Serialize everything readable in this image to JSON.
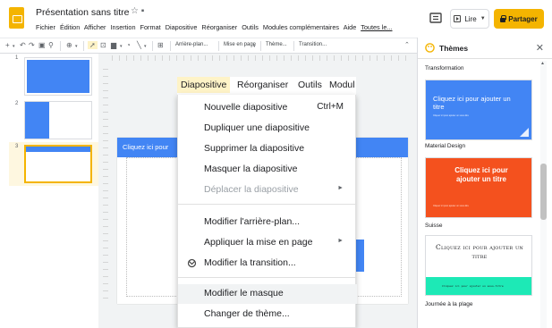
{
  "header": {
    "title": "Présentation sans titre",
    "menu": [
      "Fichier",
      "Édition",
      "Afficher",
      "Insertion",
      "Format",
      "Diapositive",
      "Réorganiser",
      "Outils",
      "Modules complémentaires",
      "Aide"
    ],
    "last_edit": "Toutes le...",
    "read_label": "Lire",
    "share_label": "Partager",
    "accent": "#f4b400"
  },
  "toolbar": {
    "background": "Arrière-plan...",
    "layout": "Mise en page",
    "theme": "Thème...",
    "transition": "Transition..."
  },
  "filmstrip": {
    "slides": [
      "1",
      "2",
      "3"
    ],
    "selected": "3"
  },
  "slide": {
    "banner_text": "Cliquez ici pour",
    "accent": "#4285f4"
  },
  "slide_menubar": {
    "items": [
      "Diapositive",
      "Réorganiser",
      "Outils",
      "Modul"
    ]
  },
  "dropdown": {
    "items": [
      {
        "label": "Nouvelle diapositive",
        "shortcut": "Ctrl+M"
      },
      {
        "label": "Dupliquer une diapositive"
      },
      {
        "label": "Supprimer la diapositive"
      },
      {
        "label": "Masquer la diapositive"
      },
      {
        "label": "Déplacer la diapositive",
        "disabled": true
      },
      {
        "label": "Modifier l'arrière-plan..."
      },
      {
        "label": "Appliquer la mise en page"
      },
      {
        "label": "Modifier la transition..."
      },
      {
        "label": "Modifier le masque"
      },
      {
        "label": "Changer de thème..."
      }
    ]
  },
  "themes_panel": {
    "title": "Thèmes",
    "close_icon": "close-icon",
    "themes": [
      {
        "name": "Transformation",
        "title_text": "Cliquez ici pour ajouter un titre",
        "subtitle_text": "Cliquez ici pour ajouter un sous-titre",
        "bg": "#4285f4"
      },
      {
        "name": "Material Design",
        "title_text": "Cliquez ici pour ajouter un titre",
        "subtitle_text": "Cliquez ici pour ajouter un sous-titre",
        "bg": "#f4511e"
      },
      {
        "name": "Suisse",
        "title_text": "Cliquez ici pour ajouter un titre",
        "subtitle_text": "Cliquez ici pour ajouter un sous-titre",
        "bg": "#ffffff",
        "band": "#1de9b6"
      },
      {
        "name": "Journée à la plage"
      }
    ]
  }
}
